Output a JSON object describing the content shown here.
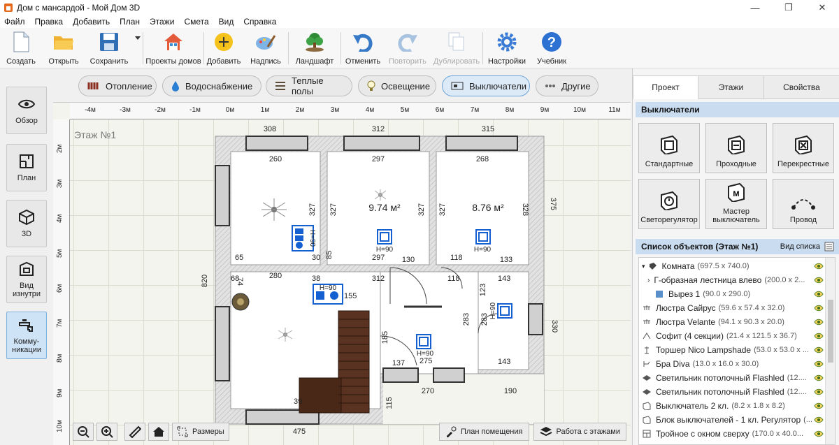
{
  "window": {
    "title": "Дом с мансардой - Мой Дом 3D",
    "minimize": "—",
    "maximize": "❐",
    "close": "✕"
  },
  "menu": [
    "Файл",
    "Правка",
    "Добавить",
    "План",
    "Этажи",
    "Смета",
    "Вид",
    "Справка"
  ],
  "toolbar": {
    "create": "Создать",
    "open": "Открыть",
    "save": "Сохранить",
    "projects": "Проекты домов",
    "add": "Добавить",
    "label": "Надпись",
    "landscape": "Ландшафт",
    "undo": "Отменить",
    "redo": "Повторить",
    "duplicate": "Дублировать",
    "settings": "Настройки",
    "tutorial": "Учебник"
  },
  "leftbar": {
    "overview": "Обзор",
    "plan": "План",
    "view3d": "3D",
    "inside_line1": "Вид",
    "inside_line2": "изнутри",
    "comm_line1": "Комму-",
    "comm_line2": "никации"
  },
  "categories": {
    "heating": "Отопление",
    "water": "Водоснабжение",
    "floors": "Теплые полы",
    "lighting": "Освещение",
    "switches": "Выключатели",
    "other": "Другие"
  },
  "ruler": {
    "top": [
      "-4м",
      "-3м",
      "-2м",
      "-1м",
      "0м",
      "1м",
      "2м",
      "3м",
      "4м",
      "5м",
      "6м",
      "7м",
      "8м",
      "9м",
      "10м",
      "11м"
    ],
    "left": [
      "2м",
      "3м",
      "4м",
      "5м",
      "6м",
      "7м",
      "8м",
      "9м",
      "10м"
    ]
  },
  "plan": {
    "floor_label": "Этаж №1",
    "dims": {
      "top_a": "308",
      "top_b": "312",
      "top_c": "315",
      "in_a": "260",
      "in_b": "297",
      "in_c": "268",
      "right_outer": "375",
      "left_outer": "820",
      "v327a": "327",
      "v327b": "327",
      "v327c": "327",
      "v327d": "327",
      "v328": "328",
      "d65": "65",
      "d30": "30",
      "d297b": "297",
      "d118a": "118",
      "d280": "280",
      "d38": "38",
      "d312": "312",
      "d118b": "118",
      "d143a": "143",
      "d68": "68",
      "d74": "74",
      "d130": "130",
      "d133": "133",
      "d85": "85",
      "d155": "155",
      "d123": "123",
      "d283a": "283",
      "d283b": "283",
      "d330": "330",
      "d143b": "143",
      "d185": "185",
      "d137": "137",
      "d275": "275",
      "d270": "270",
      "d190": "190",
      "d115": "115",
      "d39": "39",
      "d475": "475"
    },
    "area_a": "9.74 м²",
    "area_b": "8.76 м²",
    "h90": "H=90"
  },
  "canvas_tools": {
    "dimensions": "Размеры",
    "room_plan": "План помещения",
    "floors_work": "Работа с этажами"
  },
  "right": {
    "tabs": [
      "Проект",
      "Этажи",
      "Свойства"
    ],
    "section_switches": "Выключатели",
    "switches": [
      "Стандартные",
      "Проходные",
      "Перекрестные",
      "Светорегулятор",
      "Мастер выключатель",
      "Провод"
    ],
    "section_objects": "Список объектов (Этаж №1)",
    "view_list": "Вид списка",
    "objects": [
      {
        "name": "Комната",
        "dims": "(697.5 x 740.0)"
      },
      {
        "name": "Г-образная лестница влево",
        "dims": "(200.0 x 2..."
      },
      {
        "name": "Вырез 1",
        "dims": "(90.0 x 290.0)"
      },
      {
        "name": "Люстра Сайрус",
        "dims": "(59.6 x 57.4 x 32.0)"
      },
      {
        "name": "Люстра Velante",
        "dims": "(94.1 x 90.3 x 20.0)"
      },
      {
        "name": "Софит (4 секции)",
        "dims": "(21.4 x 121.5 x 36.7)"
      },
      {
        "name": "Торшер Nico Lampshade",
        "dims": "(53.0 x 53.0 x ..."
      },
      {
        "name": "Бра Diva",
        "dims": "(13.0 x 16.0 x 30.0)"
      },
      {
        "name": "Светильник потолочный Flashled",
        "dims": "(12...."
      },
      {
        "name": "Светильник потолочный Flashled",
        "dims": "(12...."
      },
      {
        "name": "Выключатель 2 кл.",
        "dims": "(8.2 x 1.8 x 8.2)"
      },
      {
        "name": "Блок выключателей - 1 кл. Регулятор",
        "dims": "(..."
      },
      {
        "name": "Тройное с окном сверху",
        "dims": "(170.0 x 40.0..."
      }
    ]
  },
  "colors": {
    "accent": "#cfe3f6",
    "section": "#c9dcf0",
    "wall": "#d8d8d8",
    "switch_blue": "#1460d0",
    "stairs": "#5a3221"
  }
}
